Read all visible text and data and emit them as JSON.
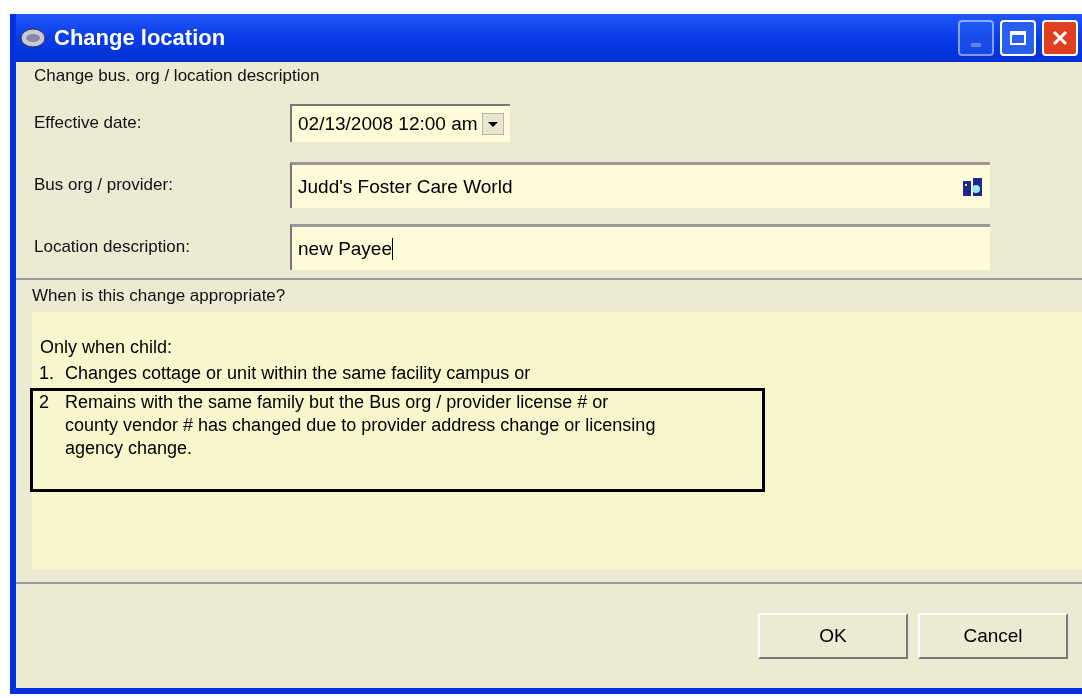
{
  "window": {
    "title": "Change location"
  },
  "section_title": "Change bus. org / location description",
  "fields": [
    {
      "kind": "dropdown",
      "label": "Effective date:",
      "value": "02/13/2008 12:00 am"
    },
    {
      "kind": "lookup",
      "label": "Bus org / provider:",
      "value": "Judd's Foster Care World"
    },
    {
      "kind": "text",
      "label": "Location description:",
      "value": "new Payee"
    }
  ],
  "help": {
    "question": "When is this change appropriate?",
    "intro": "Only when child:",
    "items": [
      {
        "number": "1.",
        "text": "Changes cottage or unit within the same facility campus or",
        "highlighted": false
      },
      {
        "number": "2",
        "text": "Remains with the same family but the Bus org / provider license # or county vendor # has changed due to provider address change or licensing agency change.",
        "highlighted": true
      }
    ]
  },
  "buttons": [
    "OK",
    "Cancel"
  ]
}
